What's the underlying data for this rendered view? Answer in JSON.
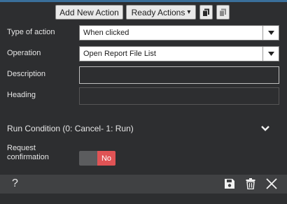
{
  "toolbar": {
    "add_new_action": "Add New Action",
    "ready_actions": "Ready Actions",
    "ready_actions_caret": "▾",
    "copy_icon": "copy-icon",
    "paste_icon": "paste-icon"
  },
  "form": {
    "type_of_action": {
      "label": "Type of action",
      "value": "When clicked"
    },
    "operation": {
      "label": "Operation",
      "value": "Open Report File List"
    },
    "description": {
      "label": "Description",
      "value": ""
    },
    "heading": {
      "label": "Heading",
      "value": ""
    }
  },
  "run_condition": {
    "label": "Run Condition (0: Cancel- 1: Run)",
    "chevron": "chevron-down-icon"
  },
  "request_confirmation": {
    "label_line1": "Request",
    "label_line2": "confirmation",
    "toggle_value": "No"
  },
  "footer": {
    "help": "?",
    "save_icon": "save-icon",
    "delete_icon": "trash-icon",
    "close_icon": "close-icon"
  },
  "colors": {
    "background": "#2d2e30",
    "toggle_off": "#e05355",
    "accent_line": "#3a6f9a"
  }
}
